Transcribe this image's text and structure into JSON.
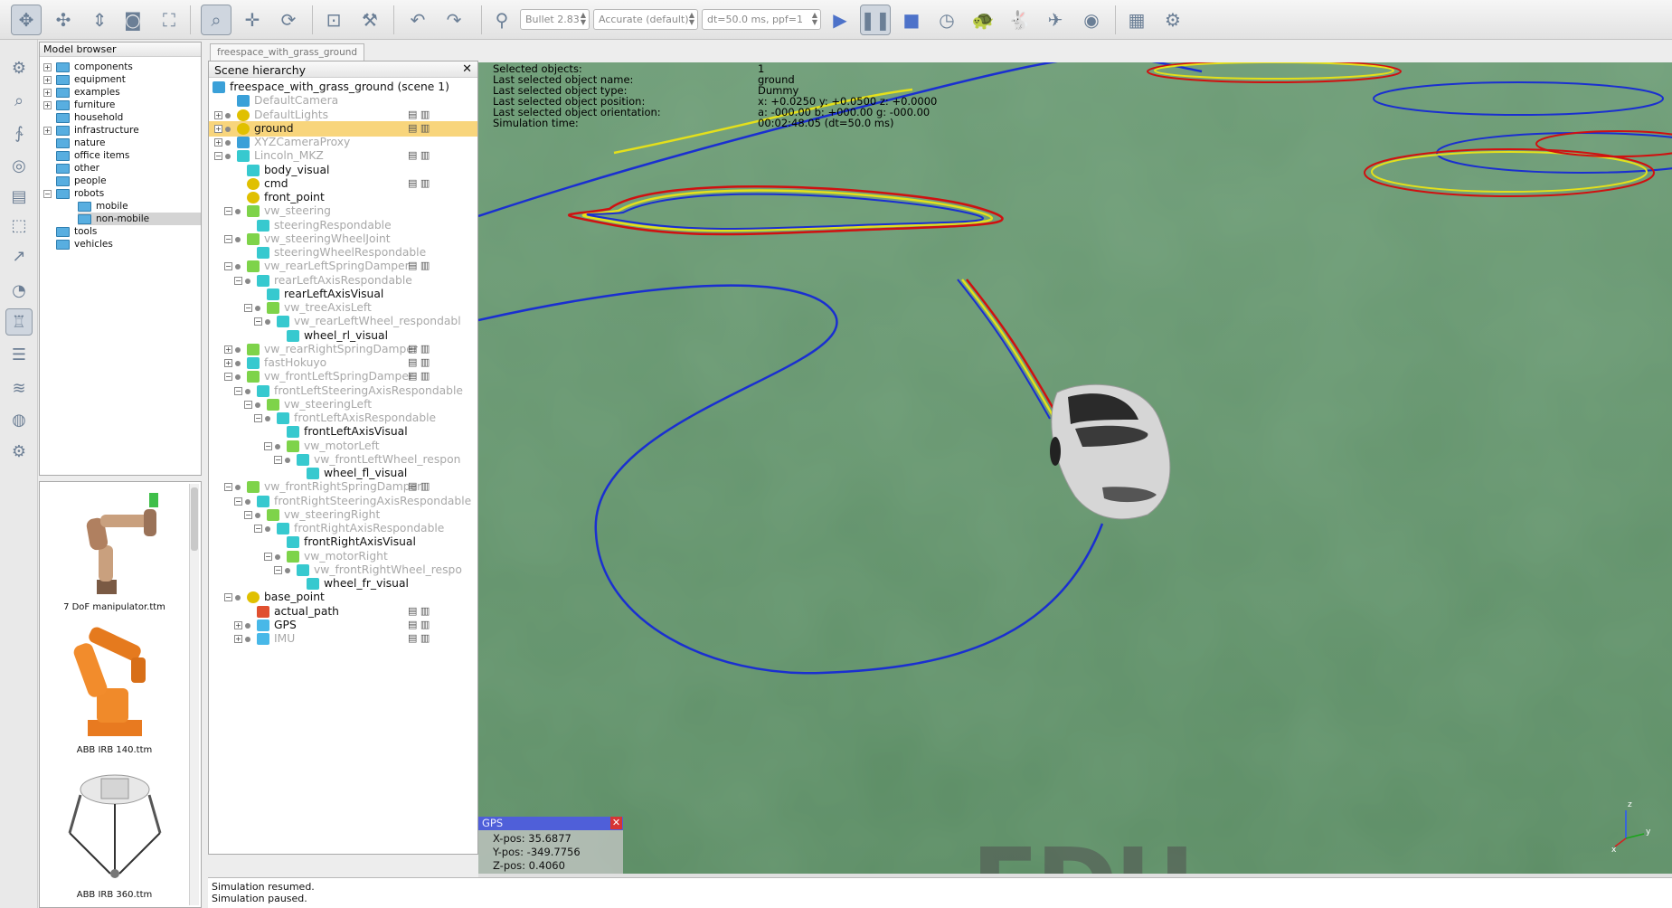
{
  "toolbar": {
    "engine_label": "Bullet 2.83",
    "accuracy_label": "Accurate (default)",
    "dt_label": "dt=50.0 ms, ppf=1"
  },
  "model_browser": {
    "title": "Model browser",
    "folders": [
      "components",
      "equipment",
      "examples",
      "furniture",
      "household",
      "infrastructure",
      "nature",
      "office items",
      "other",
      "people",
      "robots",
      "mobile",
      "non-mobile",
      "tools",
      "vehicles"
    ],
    "thumbnails": [
      "7 DoF manipulator.ttm",
      "ABB IRB 140.ttm",
      "ABB IRB 360.ttm"
    ]
  },
  "scene_tab": "freespace_with_grass_ground",
  "scene_hierarchy": {
    "title": "Scene hierarchy",
    "items": [
      "freespace_with_grass_ground (scene 1)",
      "DefaultCamera",
      "DefaultLights",
      "ground",
      "XYZCameraProxy",
      "Lincoln_MKZ",
      "body_visual",
      "cmd",
      "front_point",
      "vw_steering",
      "steeringRespondable",
      "vw_steeringWheelJoint",
      "steeringWheelRespondable",
      "vw_rearLeftSpringDamper",
      "rearLeftAxisRespondable",
      "rearLeftAxisVisual",
      "vw_treeAxisLeft",
      "vw_rearLeftWheel_respondabl",
      "wheel_rl_visual",
      "vw_rearRightSpringDamper",
      "fastHokuyo",
      "vw_frontLeftSpringDamper",
      "frontLeftSteeringAxisRespondable",
      "vw_steeringLeft",
      "frontLeftAxisRespondable",
      "frontLeftAxisVisual",
      "vw_motorLeft",
      "vw_frontLeftWheel_respon",
      "wheel_fl_visual",
      "vw_frontRightSpringDamper",
      "frontRightSteeringAxisRespondable",
      "vw_steeringRight",
      "frontRightAxisRespondable",
      "frontRightAxisVisual",
      "vw_motorRight",
      "vw_frontRightWheel_respo",
      "wheel_fr_visual",
      "base_point",
      "actual_path",
      "GPS",
      "IMU"
    ]
  },
  "info_overlay": {
    "labels": [
      "Selected objects:",
      "Last selected object name:",
      "Last selected object type:",
      "Last selected object position:",
      "Last selected object orientation:",
      "Simulation time:"
    ],
    "values": [
      "1",
      "ground",
      "Dummy",
      "x: +0.0250    y: +0.0500    z: +0.0000",
      "a: -000.00    b: +000.00    g: -000.00",
      "00:02:48.05 (dt=50.0 ms)"
    ]
  },
  "gps_panel": {
    "title": "GPS",
    "x": "X-pos: 35.6877",
    "y": "Y-pos: -349.7756",
    "z": "Z-pos: 0.4060"
  },
  "watermark": "EDU",
  "axes": {
    "z": "z",
    "y": "y",
    "x": "x"
  },
  "status_lines": [
    "Simulation resumed.",
    "Simulation paused."
  ]
}
